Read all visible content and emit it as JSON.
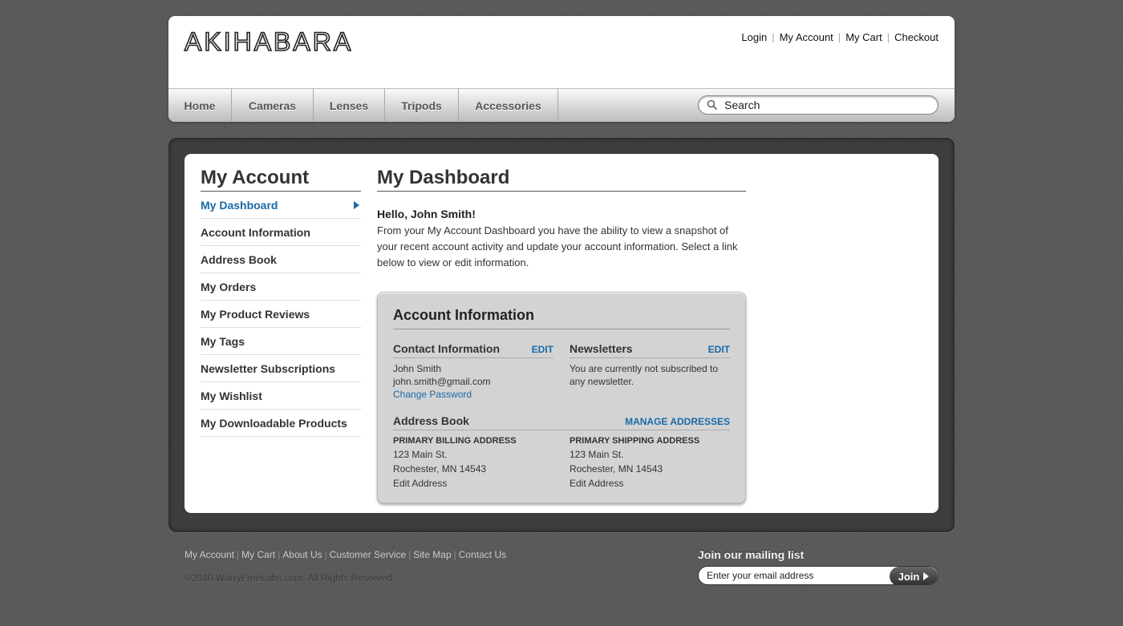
{
  "header": {
    "logo": "AKIHABARA",
    "top_links": [
      "Login",
      "My Account",
      "My Cart",
      "Checkout"
    ],
    "nav": [
      "Home",
      "Cameras",
      "Lenses",
      "Tripods",
      "Accessories"
    ],
    "search_placeholder": "Search"
  },
  "sidebar": {
    "title": "My Account",
    "items": [
      "My Dashboard",
      "Account Information",
      "Address Book",
      "My Orders",
      "My Product Reviews",
      "My Tags",
      "Newsletter Subscriptions",
      "My Wishlist",
      "My Downloadable Products"
    ]
  },
  "dashboard": {
    "title": "My Dashboard",
    "greeting": "Hello, John Smith!",
    "intro_lines": [
      "From your My Account Dashboard you have the ability to view a snapshot of",
      "your recent account activity and update your account information. Select a link",
      "below to view or edit information."
    ],
    "account_info": {
      "title": "Account Information",
      "contact": {
        "heading": "Contact Information",
        "edit": "EDIT",
        "name": "John Smith",
        "email": "john.smith@gmail.com",
        "change_password": "Change Password"
      },
      "newsletters": {
        "heading": "Newsletters",
        "edit": "EDIT",
        "line1": "You are currently not subscribed to",
        "line2": "any newsletter."
      },
      "address_book": {
        "heading": "Address Book",
        "manage": "MANAGE ADDRESSES",
        "billing": {
          "title": "PRIMARY BILLING ADDRESS",
          "street": "123 Main St.",
          "city": "Rochester, MN 14543",
          "edit": "Edit Address"
        },
        "shipping": {
          "title": "PRIMARY SHIPPING ADDRESS",
          "street": "123 Main St.",
          "city": "Rochester, MN 14543",
          "edit": "Edit Address"
        }
      }
    }
  },
  "footer": {
    "links": [
      "My Account",
      "My Cart",
      "About Us",
      "Customer Service",
      "Site Map",
      "Contact Us"
    ],
    "copyright": "©2010 WorryFreeLabs.com.  All Rights Reserved.",
    "mailing_title": "Join our mailing list",
    "email_placeholder": "Enter your email address",
    "join_label": "Join"
  },
  "colors": {
    "accent_link": "#1a6aa8",
    "background": "#595959"
  }
}
